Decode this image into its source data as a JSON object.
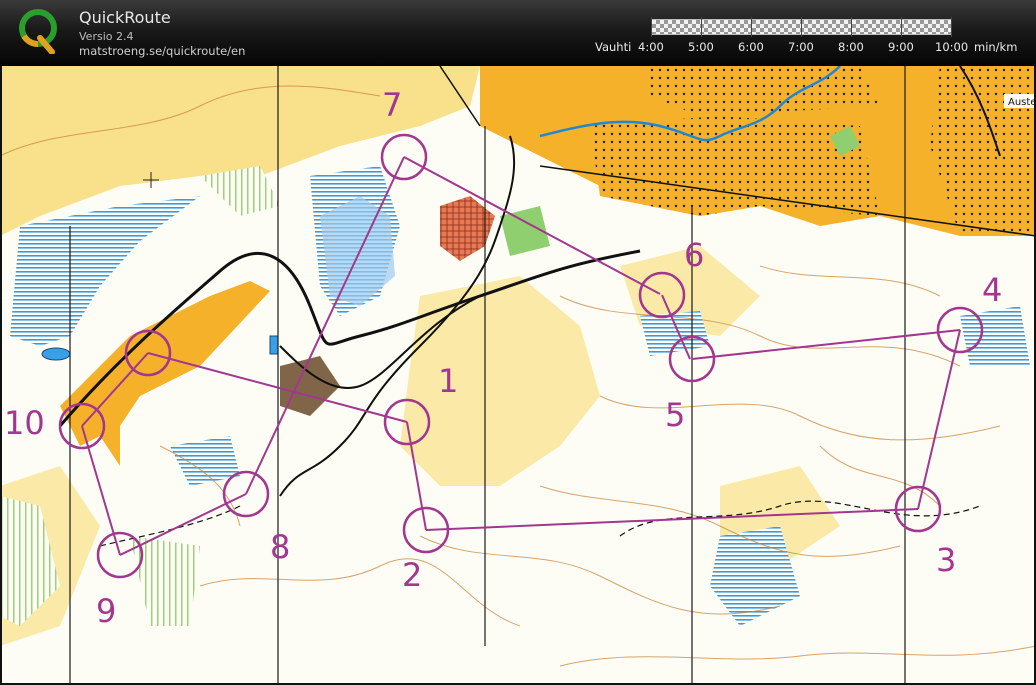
{
  "app": {
    "title": "QuickRoute",
    "version": "Versio 2.4",
    "url": "matstroeng.se/quickroute/en",
    "logo_letter": "Q"
  },
  "pace_scale": {
    "label": "Vauhti",
    "ticks": [
      "4:00",
      "5:00",
      "6:00",
      "7:00",
      "8:00",
      "9:00",
      "10:00"
    ],
    "unit": "min/km"
  },
  "map": {
    "place_label": "Auste",
    "course_color": "#a3368f",
    "controls": [
      {
        "number": "1"
      },
      {
        "number": "2"
      },
      {
        "number": "3"
      },
      {
        "number": "4"
      },
      {
        "number": "5"
      },
      {
        "number": "6"
      },
      {
        "number": "7"
      },
      {
        "number": "8"
      },
      {
        "number": "9"
      },
      {
        "number": "10"
      }
    ]
  }
}
